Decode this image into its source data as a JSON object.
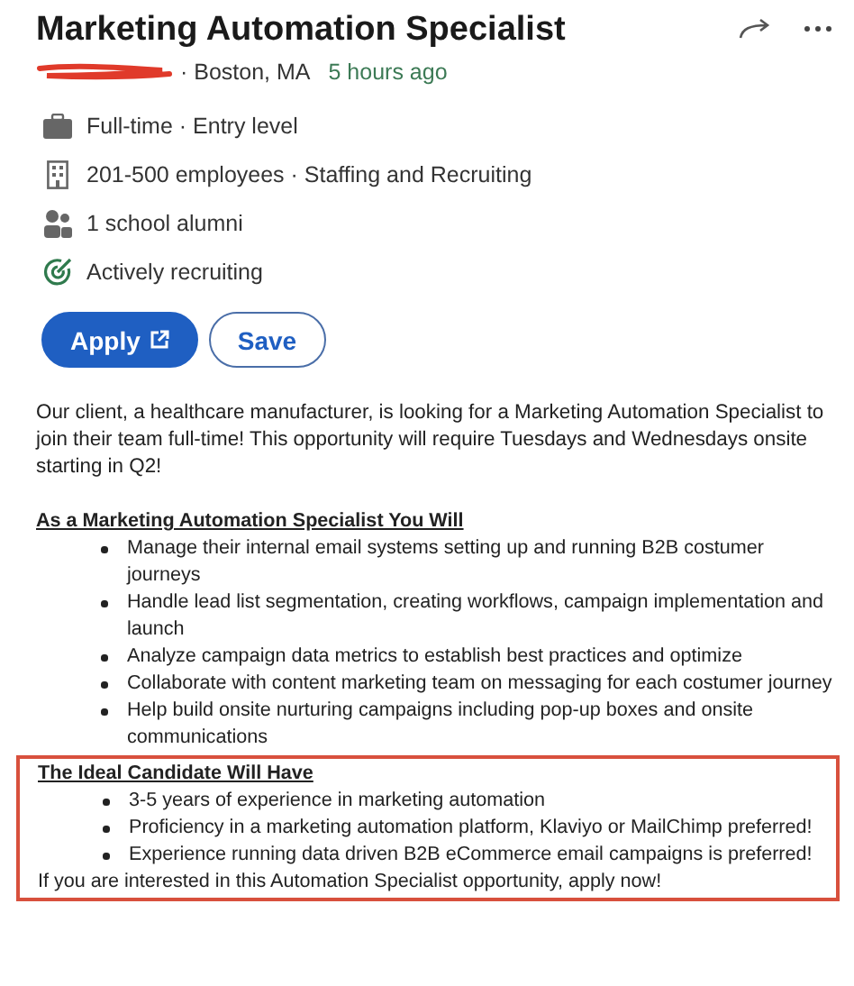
{
  "title": "Marketing Automation Specialist",
  "meta": {
    "location": "· Boston, MA",
    "posted": "5 hours ago"
  },
  "facts": [
    {
      "kind": "briefcase",
      "text": "Full-time · Entry level"
    },
    {
      "kind": "building",
      "text": "201-500 employees · Staffing and Recruiting"
    },
    {
      "kind": "people",
      "text": "1 school alumni"
    },
    {
      "kind": "target",
      "text": "Actively recruiting"
    }
  ],
  "buttons": [
    {
      "kind": "primary",
      "label": "Apply",
      "external": true
    },
    {
      "kind": "outline",
      "label": "Save",
      "external": false
    }
  ],
  "intro": "Our client, a healthcare manufacturer, is looking for a Marketing Automation Specialist to join their team full-time! This opportunity will require Tuesdays and Wednesdays onsite starting in Q2!",
  "sections": [
    {
      "heading": "As a Marketing Automation Specialist You Will",
      "highlighted": false,
      "bullets": [
        "Manage their internal email systems setting up and running B2B costumer journeys",
        "Handle lead list segmentation, creating workflows, campaign implementation and launch",
        "Analyze campaign data metrics to establish best practices and optimize",
        "Collaborate with content marketing team on messaging for each costumer journey",
        "Help build onsite nurturing campaigns including pop-up boxes and onsite communications"
      ]
    },
    {
      "heading": "The Ideal Candidate Will Have",
      "highlighted": true,
      "bullets": [
        "3-5 years of experience in marketing automation",
        "Proficiency in a marketing automation platform, Klaviyo or MailChimp preferred!",
        "Experience running data driven B2B eCommerce email campaigns is preferred!"
      ],
      "closing": "If you are interested in this Automation Specialist opportunity, apply now!"
    }
  ]
}
